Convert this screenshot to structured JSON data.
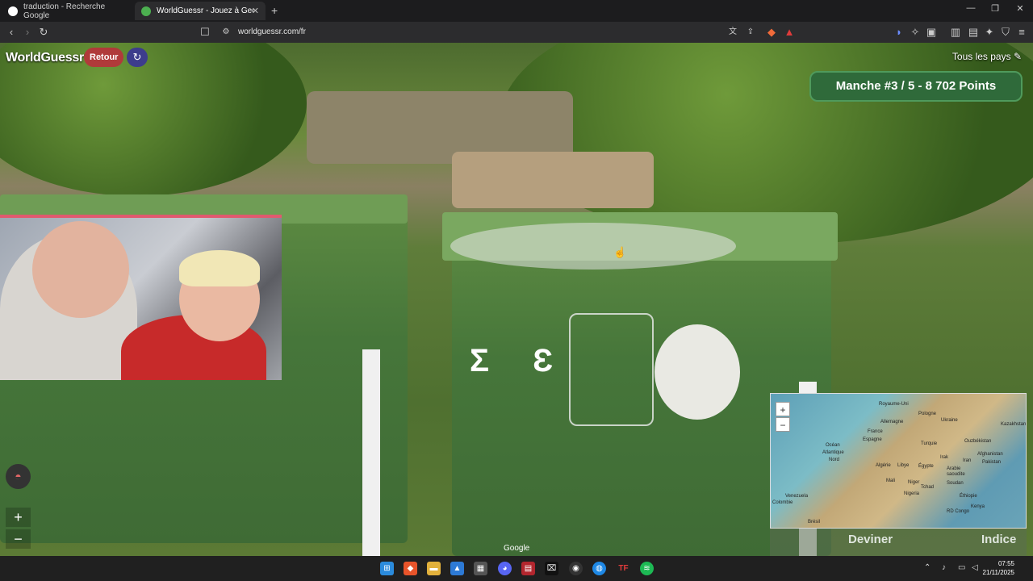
{
  "browser": {
    "tabs": [
      {
        "title": "traduction - Recherche Google",
        "active": false
      },
      {
        "title": "WorldGuessr - Jouez à GeoGues",
        "active": true
      }
    ],
    "url": "worldguessr.com/fr"
  },
  "game": {
    "logo": "WorldGuessr",
    "back_label": "Retour",
    "countries_label": "Tous les pays",
    "round_status": "Manche #3 / 5 - 8 702 Points",
    "guess_label": "Deviner",
    "hint_label": "Indice",
    "map_attribution": "Google",
    "map_labels": [
      "Royaume-Uni",
      "Pologne",
      "Allemagne",
      "Ukraine",
      "France",
      "Kazakhstan",
      "Espagne",
      "Turquie",
      "Ouzbékistan",
      "Océan",
      "Atlantique",
      "Nord",
      "Algérie",
      "Libye",
      "Égypte",
      "Irak",
      "Afghanistan",
      "Iran",
      "Pakistan",
      "Arabie",
      "saoudite",
      "Mali",
      "Niger",
      "Tchad",
      "Soudan",
      "Nigeria",
      "Éthiopie",
      "Venezuela",
      "Colombie",
      "Brésil",
      "RD Congo",
      "Kenya"
    ]
  },
  "taskbar": {
    "time": "07:55",
    "date": "21/11/2025"
  },
  "colors": {
    "round_bg": "#2f6a3a",
    "back_bg": "#b03a3a",
    "refresh_bg": "#3d3c8c"
  }
}
